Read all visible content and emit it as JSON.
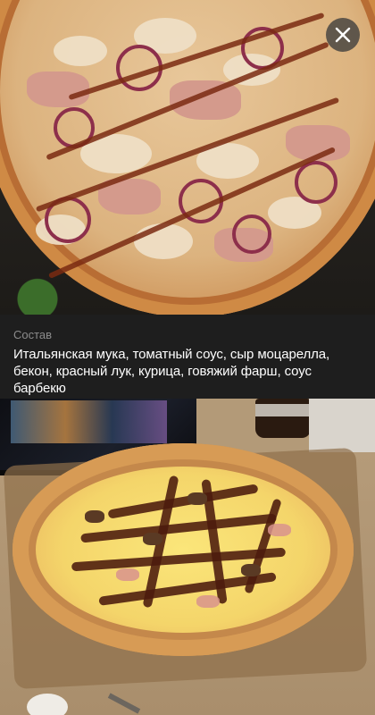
{
  "top_image": {
    "icon": "pizza-photo"
  },
  "close_button": {
    "icon": "close-icon",
    "glyph": "✕"
  },
  "composition": {
    "label": "Состав",
    "text": "Итальянская мука, томатный соус, сыр моцарелла, бекон, красный лук, курица, говяжий фарш, соус барбекю"
  },
  "bottom_image": {
    "icon": "pizza-photo"
  },
  "colors": {
    "panel_background": "#1e1e1e",
    "label_gray": "#8c8c8c",
    "text_white": "#ffffff"
  }
}
